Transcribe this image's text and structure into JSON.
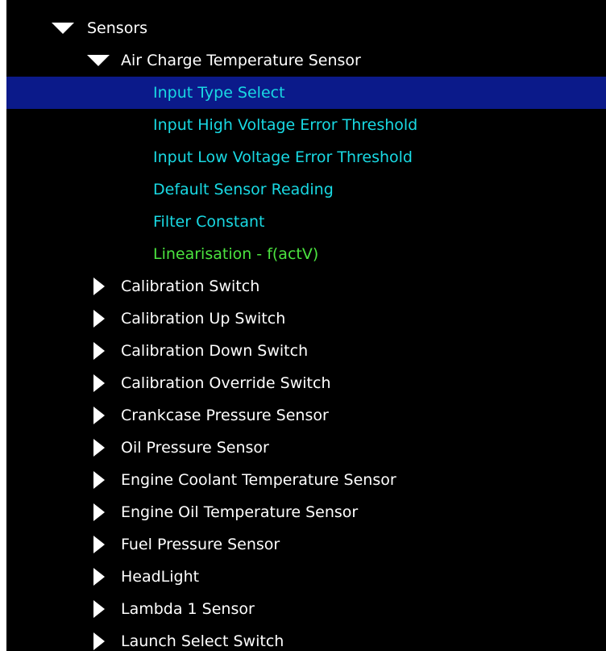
{
  "tree": {
    "root": {
      "label": "Sensors",
      "expanded": true
    },
    "group": {
      "label": "Air Charge Temperature Sensor",
      "expanded": true
    },
    "params": [
      {
        "label": "Input Type Select",
        "color": "#19d9e3",
        "selected": true
      },
      {
        "label": "Input High Voltage Error Threshold",
        "color": "#19d9e3",
        "selected": false
      },
      {
        "label": "Input Low Voltage Error Threshold",
        "color": "#19d9e3",
        "selected": false
      },
      {
        "label": "Default Sensor Reading",
        "color": "#19d9e3",
        "selected": false
      },
      {
        "label": "Filter Constant",
        "color": "#19d9e3",
        "selected": false
      },
      {
        "label": "Linearisation  - f(actV)",
        "color": "#4be33f",
        "selected": false
      }
    ],
    "collapsed_items": [
      {
        "label": "Calibration Switch"
      },
      {
        "label": "Calibration Up Switch"
      },
      {
        "label": "Calibration Down Switch"
      },
      {
        "label": "Calibration Override Switch"
      },
      {
        "label": "Crankcase Pressure Sensor"
      },
      {
        "label": "Oil Pressure Sensor"
      },
      {
        "label": "Engine Coolant Temperature Sensor"
      },
      {
        "label": "Engine Oil Temperature Sensor"
      },
      {
        "label": "Fuel Pressure Sensor"
      },
      {
        "label": "HeadLight"
      },
      {
        "label": "Lambda 1 Sensor"
      },
      {
        "label": "Launch Select Switch"
      }
    ],
    "colors": {
      "background": "#000000",
      "selection": "#0b1a8a",
      "parameter_text": "#19d9e3",
      "linearisation_text": "#4be33f",
      "item_text": "#ffffff"
    }
  }
}
